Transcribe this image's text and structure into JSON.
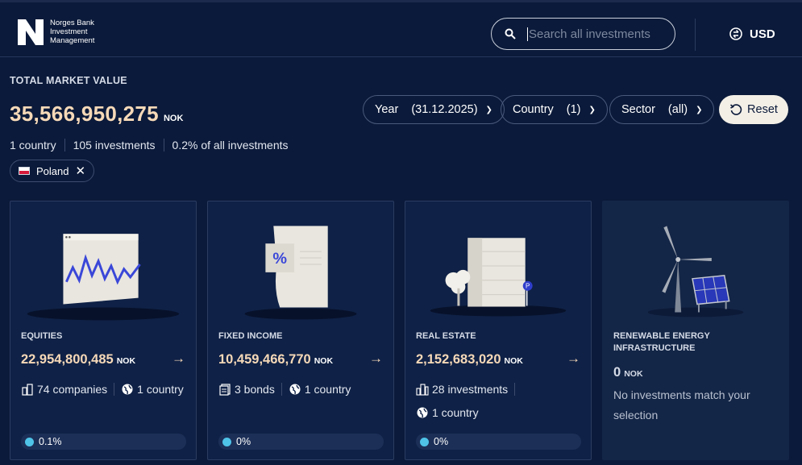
{
  "header": {
    "logo_text": [
      "Norges Bank",
      "Investment",
      "Management"
    ],
    "search_placeholder": "Search all investments",
    "currency": "USD"
  },
  "summary": {
    "label": "TOTAL MARKET VALUE",
    "total": "35,566,950,275",
    "unit": "NOK",
    "stats": [
      "1 country",
      "105 investments",
      "0.2% of all investments"
    ],
    "active_filter": "Poland"
  },
  "filters": [
    {
      "label": "Year",
      "value": "(31.12.2025)"
    },
    {
      "label": "Country",
      "value": "(1)"
    },
    {
      "label": "Sector",
      "value": "(all)"
    }
  ],
  "reset_label": "Reset",
  "cards": [
    {
      "title": "EQUITIES",
      "value": "22,954,800,485",
      "unit": "NOK",
      "meta1": "74 companies",
      "meta2": "1 country",
      "share": "0.1%"
    },
    {
      "title": "FIXED INCOME",
      "value": "10,459,466,770",
      "unit": "NOK",
      "meta1": "3 bonds",
      "meta2": "1 country",
      "share": "0%"
    },
    {
      "title": "REAL ESTATE",
      "value": "2,152,683,020",
      "unit": "NOK",
      "meta1": "28 investments",
      "meta2": "1 country",
      "share": "0%"
    },
    {
      "title": "RENEWABLE ENERGY INFRASTRUCTURE",
      "value": "0",
      "unit": "NOK",
      "message": "No investments match your selection"
    }
  ],
  "colors": {
    "background": "#0b1a3a",
    "accent": "#f6d9b8",
    "dot": "#4fc3e8",
    "reset_bg": "#f3efe7"
  }
}
